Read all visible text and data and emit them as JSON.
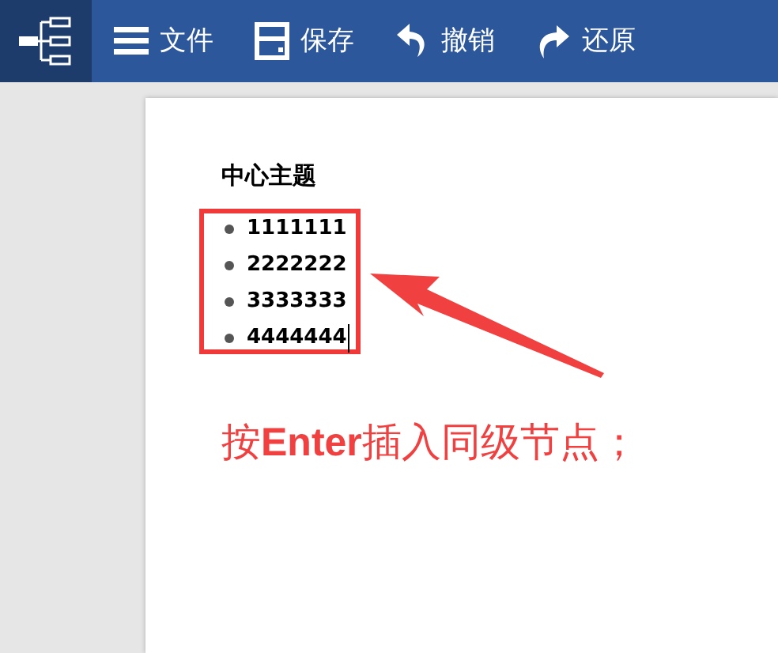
{
  "toolbar": {
    "items": [
      {
        "kind": "file",
        "label": "文件"
      },
      {
        "kind": "save",
        "label": "保存"
      },
      {
        "kind": "undo",
        "label": "撤销"
      },
      {
        "kind": "redo",
        "label": "还原"
      }
    ]
  },
  "outline": {
    "topic": "中心主题",
    "items": [
      {
        "label": "1111111",
        "focused": false
      },
      {
        "label": "2222222",
        "focused": false
      },
      {
        "label": "3333333",
        "focused": false
      },
      {
        "label": "4444444",
        "focused": true
      }
    ]
  },
  "annotation": {
    "text": "按**Enter**插入同级节点；"
  }
}
